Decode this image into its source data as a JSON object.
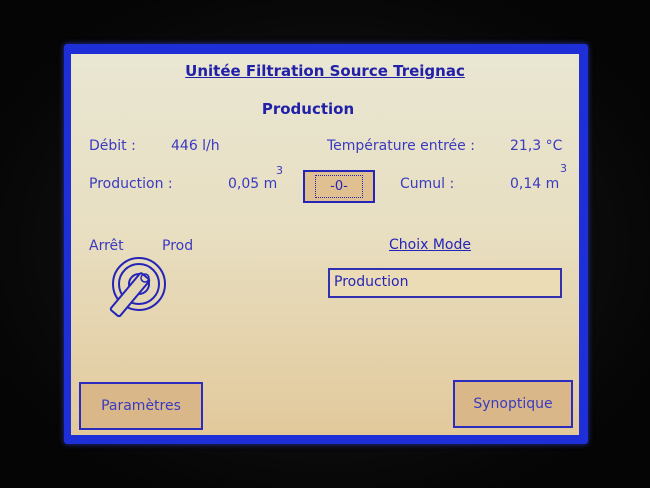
{
  "header": {
    "title": "Unitée Filtration Source Treignac",
    "subtitle": "Production"
  },
  "readings": {
    "debit_label": "Débit :",
    "debit_value": "446 l/h",
    "temp_label": "Température entrée :",
    "temp_value": "21,3 °C",
    "production_label": "Production :",
    "production_value": "0,05 m",
    "production_exp": "3",
    "cumul_label": "Cumul :",
    "cumul_value": "0,14 m",
    "cumul_exp": "3",
    "reset_label": "-0-"
  },
  "switch": {
    "left_label": "Arrêt",
    "right_label": "Prod"
  },
  "mode": {
    "link_label": "Choix Mode",
    "value": "Production"
  },
  "footer": {
    "params_label": "Paramètres",
    "synoptique_label": "Synoptique"
  }
}
